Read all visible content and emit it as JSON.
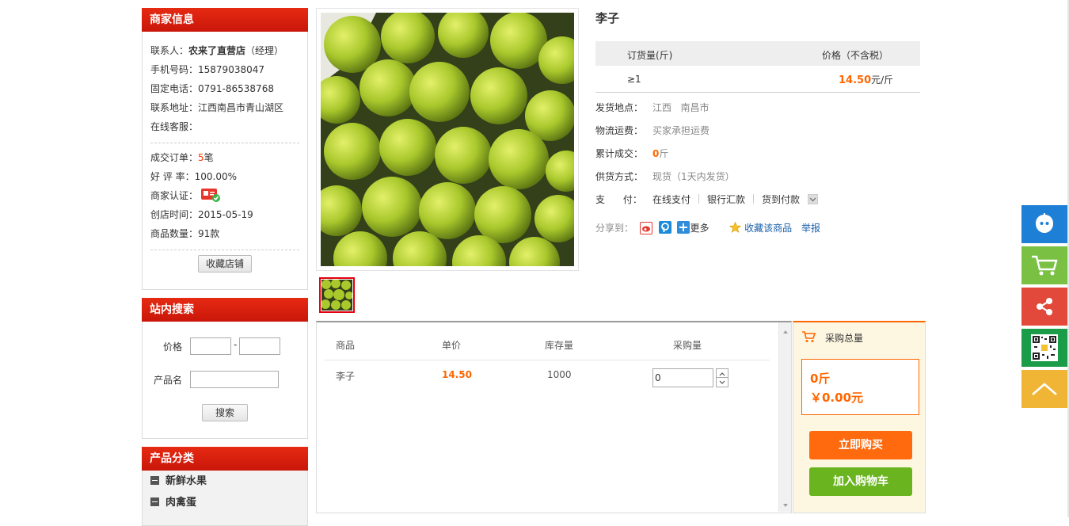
{
  "merchant": {
    "title": "商家信息",
    "contact_label": "联系人：",
    "contact_name": "农来了直营店",
    "contact_role": "（经理）",
    "mobile_label": "手机号码：",
    "mobile": "15879038047",
    "phone_label": "固定电话：",
    "phone": "0791-86538768",
    "address_label": "联系地址：",
    "address": "江西南昌市青山湖区",
    "service_label": "在线客服：",
    "orders_label": "成交订单：",
    "orders_count": "5",
    "orders_unit": "笔",
    "rate_label": "好 评 率：",
    "rate": "100.00%",
    "cert_label": "商家认证：",
    "open_label": "创店时间：",
    "open_date": "2015-05-19",
    "goods_label": "商品数量：",
    "goods_count": "91款",
    "fav_shop_button": "收藏店铺"
  },
  "site_search": {
    "title": "站内搜索",
    "price_label": "价格",
    "dash": "-",
    "name_label": "产品名",
    "search_button": "搜索"
  },
  "categories": {
    "title": "产品分类",
    "items": [
      "新鲜水果",
      "肉禽蛋"
    ]
  },
  "product": {
    "name": "李子",
    "table_header_qty": "订货量(斤)",
    "table_header_price": "价格（不含税）",
    "tier_qty": "≥1",
    "tier_price": "14.50",
    "tier_unit": "元/斤",
    "ship_from_label": "发货地点：",
    "ship_from": "江西   南昌市",
    "freight_label": "物流运费：",
    "freight": "买家承担运费",
    "sold_label": "累计成交：",
    "sold_value": "0",
    "sold_unit": "斤",
    "supply_label": "供货方式：",
    "supply": "现货（1天内发货）",
    "pay_label": "支      付：",
    "pay_methods": [
      "在线支付",
      "银行汇款",
      "货到付款"
    ],
    "share_label": "分享到：",
    "share_more": "更多",
    "fav_product": "收藏该商品",
    "report": "举报"
  },
  "purchase_table": {
    "headers": [
      "商品",
      "单价",
      "库存量",
      "采购量"
    ],
    "row": {
      "name": "李子",
      "price": "14.50",
      "stock": "1000",
      "qty": "0"
    }
  },
  "cart_summary": {
    "title": "采购总量",
    "total_qty": "0斤",
    "total_price": "￥0.00元",
    "buy_now": "立即购买",
    "add_cart": "加入购物车"
  },
  "colors": {
    "header_red": "#d9200e",
    "accent_orange": "#ff6600",
    "buy_now_bg": "#ff6a0e",
    "add_cart_bg": "#6ab41f",
    "float_blue": "#1e7fd6",
    "float_green": "#7ac143",
    "float_red": "#e2493b",
    "float_qr": "#1a9c48",
    "float_top": "#f0b535"
  }
}
